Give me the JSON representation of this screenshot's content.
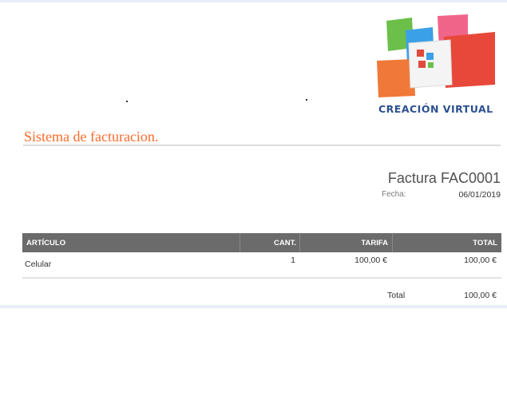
{
  "branding": {
    "system_title": "Sistema de facturacion.",
    "logo_text": "CREACIÓN VIRTUAL",
    "logo_colors": [
      "#6cc04a",
      "#f07838",
      "#3aa0e8",
      "#e85a4a",
      "#f8f8f8"
    ]
  },
  "invoice": {
    "title": "Factura FAC0001",
    "date_label": "Fecha:",
    "date_value": "06/01/2019"
  },
  "table": {
    "headers": {
      "article": "ARTÍCULO",
      "quantity": "CANT.",
      "rate": "TARIFA",
      "total": "TOTAL"
    },
    "header_color": "#6b6b6b",
    "rows": [
      {
        "article": "Celular",
        "quantity": "1",
        "rate": "100,00 €",
        "total": "100,00 €"
      }
    ]
  },
  "summary": {
    "total_label": "Total",
    "total_value": "100,00 €"
  }
}
